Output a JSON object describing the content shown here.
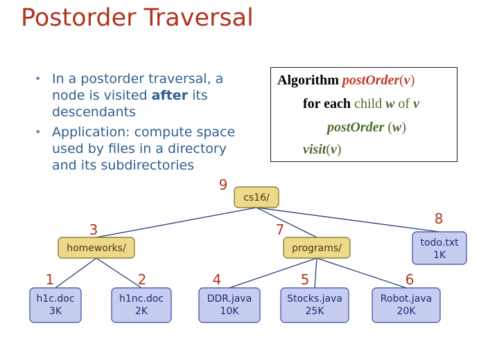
{
  "title": "Postorder Traversal",
  "bullets": [
    {
      "pre": "In a postorder traversal, a node is visited ",
      "bold": "after",
      "post": " its descendants"
    },
    {
      "pre": "Application: compute space used by files in a directory and its subdirectories",
      "bold": "",
      "post": ""
    }
  ],
  "algorithm": {
    "l1_kw": "Algorithm",
    "l1_name": "postOrder",
    "l1_open": "(",
    "l1_arg": "v",
    "l1_close": ")",
    "l2_kw": "for each",
    "l2_child": "child",
    "l2_w": "w",
    "l2_of": "of",
    "l2_v": "v",
    "l3_name": "postOrder",
    "l3_open": "(",
    "l3_arg": "w",
    "l3_close": ")",
    "l4_name": "visit",
    "l4_open": "(",
    "l4_arg": "v",
    "l4_close": ")"
  },
  "tree": {
    "nodes": [
      {
        "id": "cs16",
        "lines": [
          "cs16/"
        ],
        "order": "9",
        "kind": "folder"
      },
      {
        "id": "homeworks",
        "lines": [
          "homeworks/"
        ],
        "order": "3",
        "kind": "folder"
      },
      {
        "id": "programs",
        "lines": [
          "programs/"
        ],
        "order": "7",
        "kind": "folder"
      },
      {
        "id": "todo",
        "lines": [
          "todo.txt",
          "1K"
        ],
        "order": "8",
        "kind": "file"
      },
      {
        "id": "h1c",
        "lines": [
          "h1c.doc",
          "3K"
        ],
        "order": "1",
        "kind": "file"
      },
      {
        "id": "h1nc",
        "lines": [
          "h1nc.doc",
          "2K"
        ],
        "order": "2",
        "kind": "file"
      },
      {
        "id": "ddr",
        "lines": [
          "DDR.java",
          "10K"
        ],
        "order": "4",
        "kind": "file"
      },
      {
        "id": "stocks",
        "lines": [
          "Stocks.java",
          "25K"
        ],
        "order": "5",
        "kind": "file"
      },
      {
        "id": "robot",
        "lines": [
          "Robot.java",
          "20K"
        ],
        "order": "6",
        "kind": "file"
      }
    ],
    "edges": [
      [
        "cs16",
        "homeworks"
      ],
      [
        "cs16",
        "programs"
      ],
      [
        "cs16",
        "todo"
      ],
      [
        "homeworks",
        "h1c"
      ],
      [
        "homeworks",
        "h1nc"
      ],
      [
        "programs",
        "ddr"
      ],
      [
        "programs",
        "stocks"
      ],
      [
        "programs",
        "robot"
      ]
    ],
    "colors": {
      "folder_fill": "#ecd98a",
      "folder_stroke": "#7a6a2a",
      "file_fill": "#c6cdf0",
      "file_stroke": "#3a4a9a",
      "edge": "#2a3a7a",
      "order_text": "#b0341e"
    }
  }
}
